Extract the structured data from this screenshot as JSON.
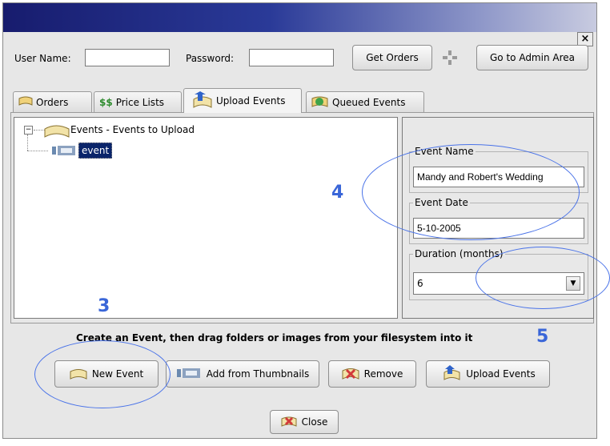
{
  "dialog": {
    "close_x": "×"
  },
  "login": {
    "username_label": "User Name:",
    "username_value": "",
    "password_label": "Password:",
    "password_value": "",
    "get_orders": "Get Orders",
    "admin": "Go to Admin Area"
  },
  "tabs": [
    {
      "label": "Orders",
      "icon": "book-icon"
    },
    {
      "label": "Price Lists",
      "icon": "dollar-icon"
    },
    {
      "label": "Upload Events",
      "icon": "upload-icon",
      "active": true
    },
    {
      "label": "Queued Events",
      "icon": "queue-icon"
    }
  ],
  "tree": {
    "root_label": "Events -  Events to Upload",
    "child_label": "event"
  },
  "details": {
    "event_name_label": "Event Name",
    "event_name_value": "Mandy and Robert's Wedding",
    "event_date_label": "Event Date",
    "event_date_value": "5-10-2005",
    "duration_label": "Duration (months)",
    "duration_value": "6"
  },
  "instruction": "Create an Event, then drag folders or images from your filesystem into it",
  "actions": {
    "new_event": "New Event",
    "add_thumbnails": "Add from Thumbnails",
    "remove": "Remove",
    "upload": "Upload Events"
  },
  "close_button": "Close",
  "annotations": {
    "a3": "3",
    "a4": "4",
    "a5": "5"
  },
  "colors": {
    "annotation": "#3a66d8",
    "titlebar": "#1c2272",
    "selection": "#0a246a"
  }
}
